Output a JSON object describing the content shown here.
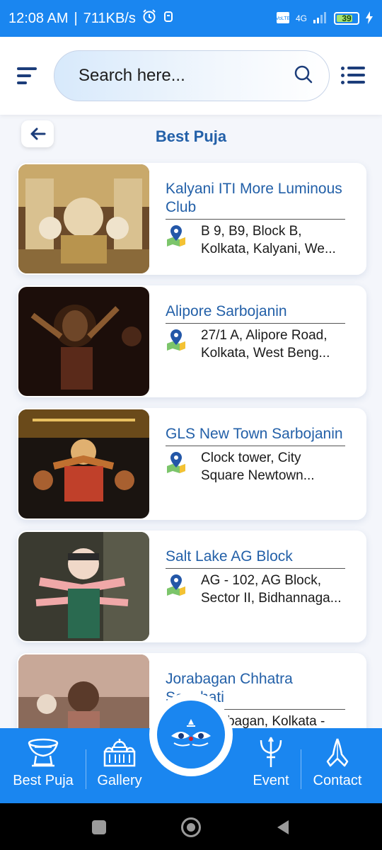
{
  "status_bar": {
    "time": "12:08 AM",
    "separator": "|",
    "speed": "711KB/s",
    "network": "4G",
    "battery": "39"
  },
  "header": {
    "search_placeholder": "Search here..."
  },
  "page": {
    "title": "Best Puja"
  },
  "pujas": [
    {
      "name": "Kalyani ITI More Luminous Club",
      "address": "B 9, B9, Block B,\nKolkata, Kalyani, We..."
    },
    {
      "name": "Alipore Sarbojanin",
      "address": "27/1 A, Alipore Road,\nKolkata, West Beng..."
    },
    {
      "name": "GLS New Town Sarbojanin",
      "address": "Clock tower, City\nSquare Newtown..."
    },
    {
      "name": "Salt Lake AG Block",
      "address": "AG - 102, AG Block,\nSector II, Bidhannaga..."
    },
    {
      "name": "Jorabagan Chhatra Sanghati",
      "address": "Jorabagan, Kolkata -"
    }
  ],
  "bottom_nav": {
    "best_puja": "Best Puja",
    "gallery": "Gallery",
    "event": "Event",
    "contact": "Contact"
  },
  "colors": {
    "accent": "#1a86f0",
    "title_blue": "#2360a8",
    "dark_navy": "#1c3d7a"
  }
}
